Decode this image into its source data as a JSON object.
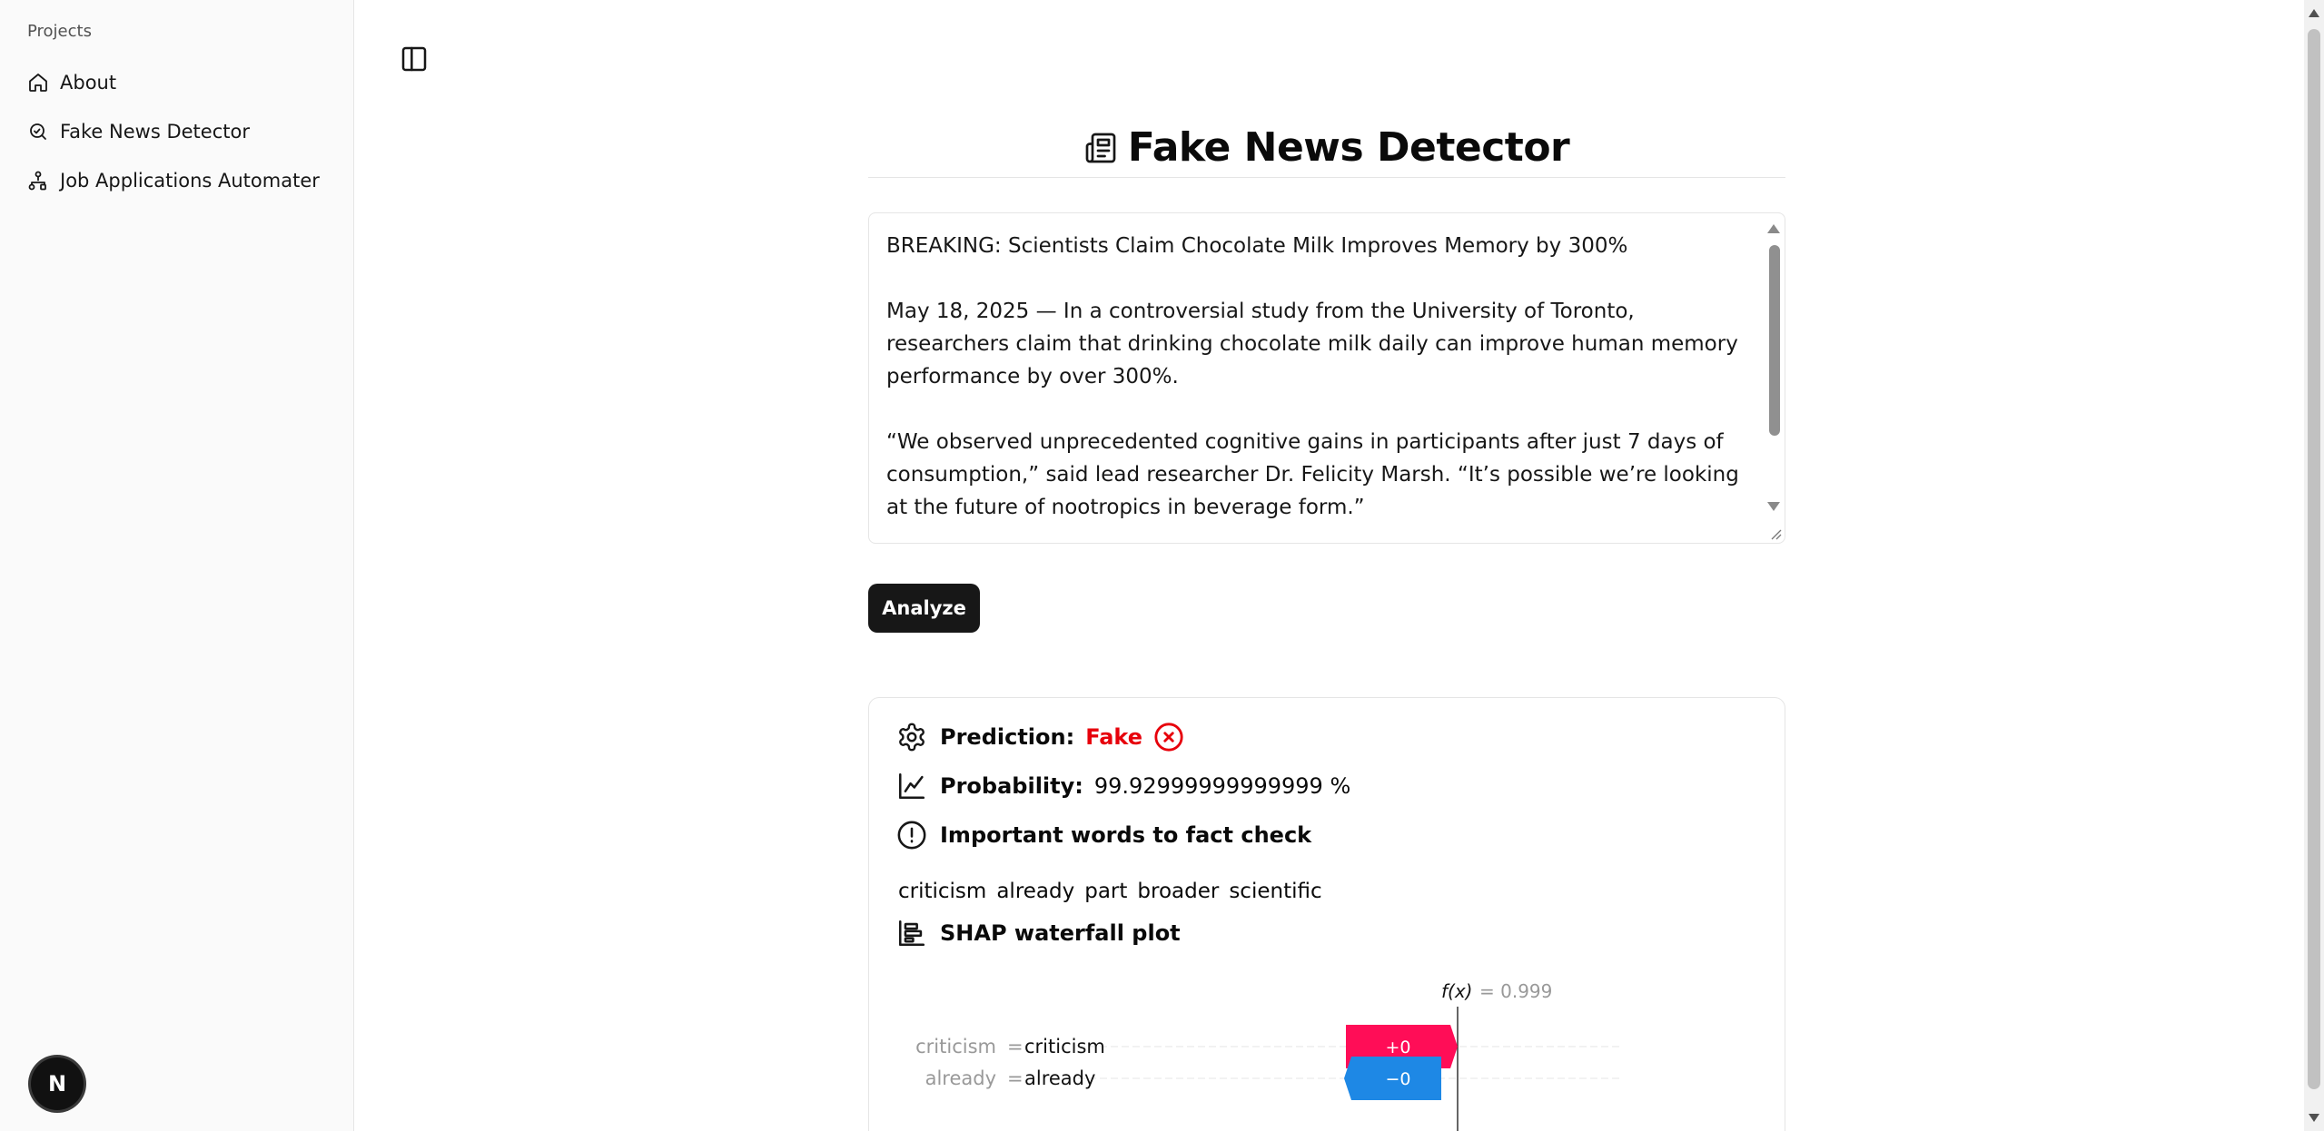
{
  "sidebar": {
    "group_label": "Projects",
    "items": [
      {
        "label": "About",
        "icon": "home-icon"
      },
      {
        "label": "Fake News Detector",
        "icon": "search-file-icon"
      },
      {
        "label": "Job Applications Automater",
        "icon": "workflow-icon"
      }
    ],
    "avatar_letter": "N"
  },
  "main": {
    "title": "Fake News Detector",
    "title_icon": "newspaper-icon",
    "article": {
      "headline": "BREAKING: Scientists Claim Chocolate Milk Improves Memory by 300%",
      "paragraph1": "May 18, 2025 — In a controversial study from the University of Toronto, researchers claim that drinking chocolate milk daily can improve human memory performance by over 300%.",
      "paragraph2": "“We observed unprecedented cognitive gains in participants after just 7 days of consumption,” said lead researcher Dr. Felicity Marsh. “It’s possible we’re looking at the future of nootropics in beverage form.”"
    },
    "analyze_label": "Analyze",
    "result": {
      "prediction_label": "Prediction:",
      "prediction_value": "Fake",
      "probability_label": "Probability:",
      "probability_value": "99.92999999999999 %",
      "words_heading": "Important words to fact check",
      "words": [
        "criticism",
        "already",
        "part",
        "broader",
        "scientific"
      ],
      "shap_heading": "SHAP waterfall plot",
      "colors": {
        "fake": "#e7000b",
        "positive": "#ff0d57",
        "negative": "#1e88e5"
      }
    }
  },
  "chart_data": {
    "type": "bar",
    "title": "",
    "fx_label": "f(x)",
    "fx_value": "= 0.999",
    "rows": [
      {
        "feature": "criticism",
        "value": "criticism",
        "shap_label": "+0",
        "sign": "positive"
      },
      {
        "feature": "already",
        "value": "already",
        "shap_label": "−0",
        "sign": "negative"
      }
    ]
  }
}
